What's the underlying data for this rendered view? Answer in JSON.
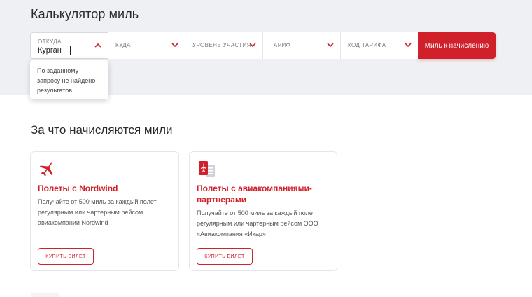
{
  "calculator": {
    "title": "Калькулятор миль",
    "from": {
      "label": "ОТКУДА",
      "value": "Курган"
    },
    "to": {
      "label": "КУДА"
    },
    "level": {
      "label": "УРОВЕНЬ УЧАСТИЯ"
    },
    "tariff": {
      "label": "ТАРИФ"
    },
    "tariff_code": {
      "label": "КОД ТАРИФА"
    },
    "submit_label": "Миль к начислению",
    "suggestion_empty": "По заданному запросу не найдено результатов"
  },
  "earn_section": {
    "title": "За что начисляются мили",
    "cards": [
      {
        "title": "Полеты с Nordwind",
        "description": "Получайте от 500 миль за каждый полет регулярным или чартерным рейсом авиакомпании Nordwind",
        "button_label": "КУПИТЬ БИЛЕТ",
        "icon": "plane-icon"
      },
      {
        "title": "Полеты с авиакомпаниями-партнерами",
        "description": "Получайте от 500 миль за каждый полет регулярным или чартерным рейсом ООО «Авиакомпания «Икар»",
        "button_label": "КУПИТЬ БИЛЕТ",
        "icon": "partner-ticket-icon"
      }
    ]
  },
  "colors": {
    "accent": "#d0202a",
    "band": "#eef0f3"
  }
}
